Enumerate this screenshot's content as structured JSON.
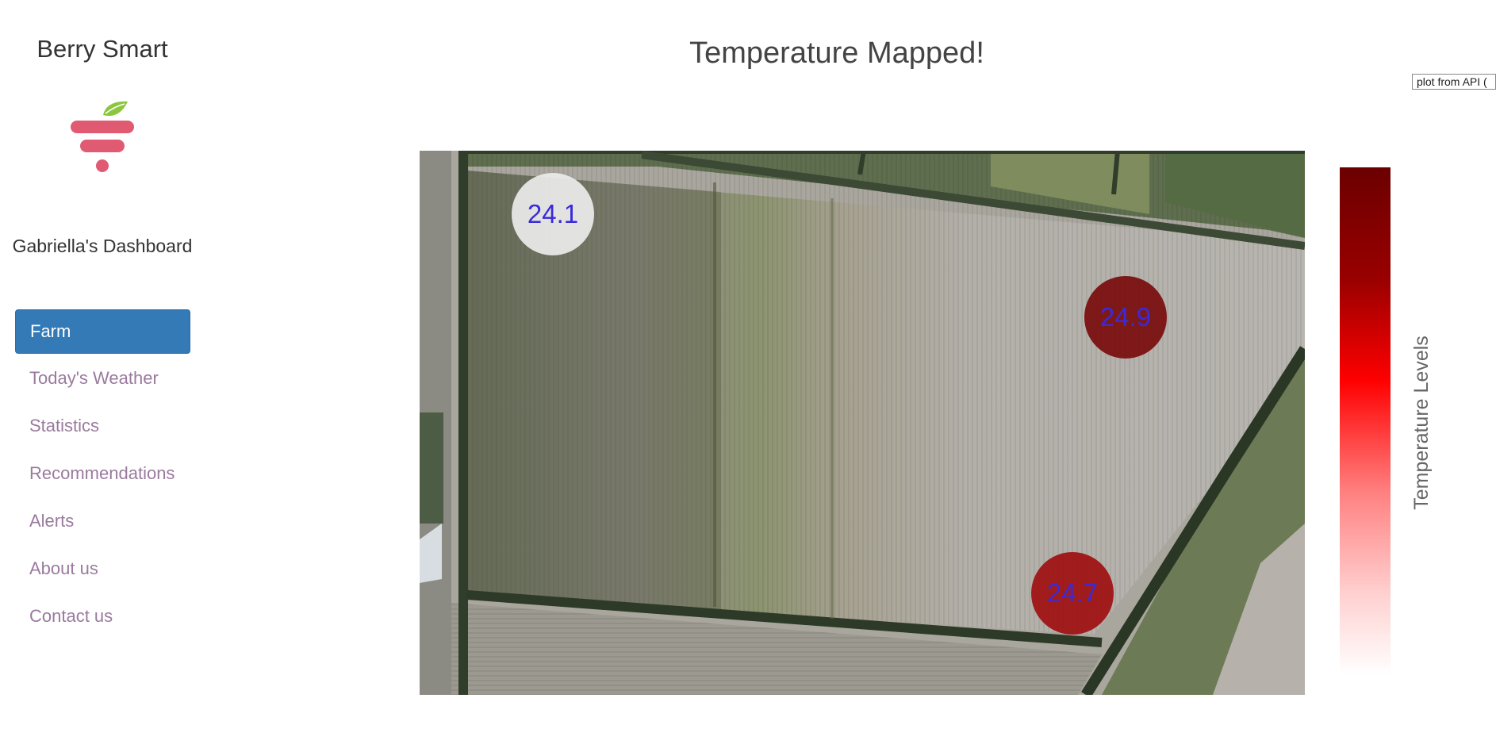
{
  "sidebar": {
    "app_title": "Berry Smart",
    "logo": {
      "icon": "berry-logo-icon",
      "berry_color": "#e05a72",
      "leaf_color": "#8cc63f"
    },
    "dashboard_title": "Gabriella's Dashboard",
    "nav": [
      {
        "label": "Farm",
        "active": true
      },
      {
        "label": "Today's Weather",
        "active": false
      },
      {
        "label": "Statistics",
        "active": false
      },
      {
        "label": "Recommendations",
        "active": false
      },
      {
        "label": "Alerts",
        "active": false
      },
      {
        "label": "About us",
        "active": false
      },
      {
        "label": "Contact us",
        "active": false
      }
    ]
  },
  "plot": {
    "title": "Temperature Mapped!",
    "api_tag": "plot from API (",
    "colorbar_label": "Temperature Levels",
    "markers": [
      {
        "value": "24.1",
        "color": "#ececec"
      },
      {
        "value": "24.9",
        "color": "#7a0c0c"
      },
      {
        "value": "24.7",
        "color": "#a01010"
      }
    ],
    "marker_text_color": "#3a2ad8"
  }
}
